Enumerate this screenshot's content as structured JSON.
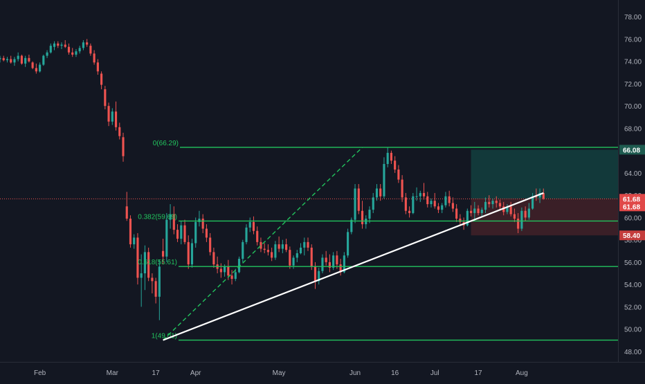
{
  "chart_data": {
    "type": "candlestick",
    "title": "",
    "xlabel": "",
    "ylabel": "",
    "grid": false,
    "colors": {
      "background": "#131722",
      "up": "#26a69a",
      "down": "#ef5350",
      "fib": "#22c55e",
      "trendline": "#ffffff",
      "axis_text": "#b2b5be",
      "target_zone": "#12393a",
      "stop_zone": "#3a1f27",
      "target_tag": "#1e5b50",
      "price_tag": "#e04848",
      "stop_tag": "#c43c3c"
    },
    "y_axis": {
      "ylim": [
        47,
        79.5
      ],
      "ticks": [
        "48.00",
        "50.00",
        "52.00",
        "54.00",
        "56.00",
        "58.00",
        "60.00",
        "62.00",
        "64.00",
        "66.00",
        "68.00",
        "70.00",
        "72.00",
        "74.00",
        "76.00",
        "78.00"
      ],
      "tick_values": [
        48,
        50,
        52,
        54,
        56,
        58,
        60,
        62,
        64,
        66,
        68,
        70,
        72,
        74,
        76,
        78
      ]
    },
    "x_axis": {
      "xlim": [
        0,
        170
      ],
      "labels": [
        {
          "label": "Feb",
          "x": 11
        },
        {
          "label": "Mar",
          "x": 31
        },
        {
          "label": "17",
          "x": 43
        },
        {
          "label": "Apr",
          "x": 54
        },
        {
          "label": "May",
          "x": 77
        },
        {
          "label": "Jun",
          "x": 98
        },
        {
          "label": "16",
          "x": 109
        },
        {
          "label": "Jul",
          "x": 120
        },
        {
          "label": "17",
          "x": 132
        },
        {
          "label": "Aug",
          "x": 144
        }
      ]
    },
    "candles": [
      [
        0,
        74.2,
        74.5,
        73.9,
        74.3
      ],
      [
        1,
        74.3,
        74.5,
        74.0,
        74.1
      ],
      [
        2,
        74.1,
        74.4,
        73.9,
        74.2
      ],
      [
        3,
        74.2,
        74.5,
        73.8,
        73.9
      ],
      [
        4,
        73.9,
        74.4,
        73.6,
        74.2
      ],
      [
        5,
        74.2,
        74.8,
        74.0,
        74.5
      ],
      [
        6,
        74.5,
        74.6,
        73.7,
        73.8
      ],
      [
        7,
        73.8,
        74.5,
        73.5,
        74.3
      ],
      [
        8,
        74.3,
        74.6,
        73.9,
        74.0
      ],
      [
        9,
        73.9,
        74.0,
        73.3,
        73.4
      ],
      [
        10,
        73.4,
        73.8,
        72.9,
        73.1
      ],
      [
        11,
        73.1,
        73.9,
        73.0,
        73.7
      ],
      [
        12,
        73.7,
        74.6,
        73.6,
        74.5
      ],
      [
        13,
        74.5,
        75.0,
        74.3,
        74.8
      ],
      [
        14,
        74.8,
        75.6,
        74.7,
        75.4
      ],
      [
        15,
        75.3,
        75.8,
        75.0,
        75.6
      ],
      [
        16,
        75.6,
        75.8,
        75.2,
        75.4
      ],
      [
        17,
        75.4,
        75.7,
        75.1,
        75.5
      ],
      [
        18,
        75.5,
        75.9,
        75.2,
        75.3
      ],
      [
        19,
        75.3,
        75.6,
        74.6,
        74.8
      ],
      [
        20,
        74.8,
        75.2,
        74.4,
        74.6
      ],
      [
        21,
        74.6,
        75.1,
        74.4,
        74.9
      ],
      [
        22,
        74.9,
        75.4,
        74.7,
        75.2
      ],
      [
        23,
        75.2,
        75.9,
        75.0,
        75.7
      ],
      [
        24,
        75.7,
        76.0,
        75.3,
        75.5
      ],
      [
        25,
        75.4,
        75.6,
        74.5,
        74.7
      ],
      [
        26,
        74.7,
        75.0,
        73.7,
        73.9
      ],
      [
        27,
        73.9,
        74.2,
        72.8,
        73.1
      ],
      [
        28,
        72.9,
        73.1,
        71.5,
        71.9
      ],
      [
        29,
        71.5,
        71.8,
        69.7,
        70.0
      ],
      [
        30,
        70.0,
        70.3,
        68.2,
        68.6
      ],
      [
        31,
        68.6,
        69.8,
        68.3,
        69.5
      ],
      [
        32,
        69.5,
        70.4,
        67.8,
        68.1
      ],
      [
        33,
        68.1,
        68.5,
        67.0,
        67.3
      ],
      [
        34,
        67.2,
        67.6,
        65.0,
        65.5
      ],
      [
        35,
        61.0,
        62.3,
        59.7,
        59.9
      ],
      [
        36,
        59.9,
        60.2,
        57.3,
        57.6
      ],
      [
        37,
        57.6,
        58.5,
        57.2,
        58.2
      ],
      [
        38,
        58.2,
        58.6,
        54.0,
        54.6
      ],
      [
        39,
        54.6,
        56.7,
        52.0,
        55.0
      ],
      [
        40,
        55.0,
        57.5,
        53.5,
        56.9
      ],
      [
        41,
        56.9,
        57.3,
        54.3,
        54.6
      ],
      [
        42,
        54.6,
        55.0,
        53.2,
        54.3
      ],
      [
        43,
        54.3,
        54.6,
        52.3,
        52.9
      ],
      [
        44,
        52.9,
        56.2,
        50.8,
        55.6
      ],
      [
        45,
        57.0,
        58.1,
        55.8,
        56.5
      ],
      [
        46,
        56.5,
        60.4,
        56.0,
        59.8
      ],
      [
        47,
        59.8,
        61.2,
        59.0,
        60.3
      ],
      [
        48,
        60.3,
        61.0,
        58.5,
        58.9
      ],
      [
        49,
        58.9,
        59.4,
        57.8,
        58.1
      ],
      [
        50,
        58.1,
        59.7,
        57.6,
        59.3
      ],
      [
        51,
        59.3,
        59.8,
        57.6,
        57.8
      ],
      [
        52,
        57.8,
        58.4,
        55.4,
        55.8
      ],
      [
        53,
        55.8,
        58.1,
        55.5,
        57.7
      ],
      [
        54,
        57.7,
        60.0,
        57.3,
        59.6
      ],
      [
        55,
        59.6,
        60.6,
        59.2,
        59.9
      ],
      [
        56,
        59.9,
        60.3,
        58.6,
        59.0
      ],
      [
        57,
        59.0,
        59.4,
        57.8,
        58.2
      ],
      [
        58,
        58.2,
        58.6,
        56.6,
        56.9
      ],
      [
        59,
        56.9,
        57.3,
        55.5,
        55.8
      ],
      [
        60,
        55.8,
        56.5,
        55.0,
        55.4
      ],
      [
        61,
        55.4,
        55.9,
        54.6,
        55.1
      ],
      [
        62,
        55.1,
        55.8,
        54.7,
        55.6
      ],
      [
        63,
        55.6,
        56.2,
        54.4,
        54.8
      ],
      [
        64,
        54.8,
        55.3,
        54.0,
        54.5
      ],
      [
        65,
        54.5,
        55.4,
        54.3,
        55.1
      ],
      [
        66,
        55.1,
        56.5,
        55.0,
        56.3
      ],
      [
        67,
        56.3,
        58.0,
        56.0,
        57.8
      ],
      [
        68,
        57.8,
        59.4,
        57.6,
        59.1
      ],
      [
        69,
        59.1,
        60.0,
        58.7,
        59.6
      ],
      [
        70,
        59.6,
        60.1,
        58.5,
        58.8
      ],
      [
        71,
        58.8,
        59.2,
        57.5,
        57.8
      ],
      [
        72,
        57.8,
        58.2,
        56.9,
        57.2
      ],
      [
        73,
        57.2,
        57.7,
        56.8,
        57.1
      ],
      [
        74,
        57.1,
        57.6,
        56.6,
        56.9
      ],
      [
        75,
        56.9,
        57.3,
        56.1,
        56.4
      ],
      [
        76,
        56.4,
        57.9,
        56.2,
        57.6
      ],
      [
        77,
        57.6,
        58.3,
        56.9,
        57.2
      ],
      [
        78,
        57.2,
        58.0,
        56.8,
        57.6
      ],
      [
        79,
        57.6,
        58.1,
        56.9,
        57.1
      ],
      [
        80,
        57.1,
        57.4,
        55.4,
        55.7
      ],
      [
        81,
        55.7,
        56.6,
        55.4,
        56.4
      ],
      [
        82,
        56.4,
        57.1,
        56.0,
        56.8
      ],
      [
        83,
        56.8,
        57.7,
        56.7,
        57.3
      ],
      [
        84,
        57.3,
        58.2,
        56.6,
        57.8
      ],
      [
        85,
        57.8,
        58.2,
        57.0,
        57.3
      ],
      [
        86,
        57.3,
        57.6,
        55.3,
        55.6
      ],
      [
        87,
        55.6,
        56.0,
        53.6,
        54.3
      ],
      [
        88,
        54.3,
        55.5,
        54.0,
        55.2
      ],
      [
        89,
        55.2,
        56.7,
        55.0,
        56.4
      ],
      [
        90,
        56.4,
        57.0,
        55.7,
        56.0
      ],
      [
        91,
        56.0,
        56.7,
        55.1,
        55.5
      ],
      [
        92,
        55.5,
        56.9,
        55.3,
        56.6
      ],
      [
        93,
        56.6,
        57.0,
        55.4,
        55.8
      ],
      [
        94,
        55.8,
        56.3,
        54.8,
        55.1
      ],
      [
        95,
        55.1,
        56.9,
        55.0,
        56.6
      ],
      [
        96,
        56.6,
        59.0,
        56.4,
        58.7
      ],
      [
        97,
        58.7,
        60.0,
        58.5,
        59.8
      ],
      [
        98,
        59.8,
        63.0,
        59.5,
        62.6
      ],
      [
        99,
        62.6,
        63.0,
        60.3,
        60.6
      ],
      [
        100,
        60.6,
        61.5,
        59.0,
        59.4
      ],
      [
        101,
        59.4,
        60.2,
        59.0,
        59.9
      ],
      [
        102,
        59.9,
        61.0,
        59.5,
        60.7
      ],
      [
        103,
        60.7,
        62.2,
        60.4,
        61.8
      ],
      [
        104,
        61.8,
        63.0,
        61.5,
        62.6
      ],
      [
        105,
        62.6,
        63.0,
        61.5,
        61.9
      ],
      [
        106,
        61.9,
        65.4,
        61.7,
        64.8
      ],
      [
        107,
        64.8,
        66.3,
        64.5,
        65.8
      ],
      [
        108,
        65.8,
        66.0,
        64.8,
        65.1
      ],
      [
        109,
        65.1,
        65.5,
        64.0,
        64.3
      ],
      [
        110,
        64.3,
        64.7,
        63.1,
        63.4
      ],
      [
        111,
        63.4,
        63.8,
        61.4,
        61.8
      ],
      [
        112,
        61.8,
        62.2,
        60.3,
        60.6
      ],
      [
        113,
        60.6,
        61.0,
        60.0,
        60.4
      ],
      [
        114,
        60.4,
        62.2,
        60.3,
        61.9
      ],
      [
        115,
        61.9,
        62.7,
        61.5,
        61.9
      ],
      [
        116,
        61.9,
        62.4,
        61.4,
        62.2
      ],
      [
        117,
        62.2,
        63.1,
        61.6,
        61.9
      ],
      [
        118,
        61.9,
        62.3,
        60.9,
        61.2
      ],
      [
        119,
        61.2,
        61.7,
        60.9,
        61.5
      ],
      [
        120,
        61.5,
        62.2,
        60.8,
        61.0
      ],
      [
        121,
        61.0,
        61.3,
        60.4,
        60.7
      ],
      [
        122,
        60.7,
        61.3,
        60.4,
        61.1
      ],
      [
        123,
        61.1,
        62.3,
        60.9,
        61.9
      ],
      [
        124,
        61.9,
        62.4,
        61.0,
        61.3
      ],
      [
        125,
        61.3,
        61.8,
        60.5,
        60.8
      ],
      [
        126,
        60.8,
        61.2,
        59.6,
        59.9
      ],
      [
        127,
        59.9,
        60.3,
        59.3,
        59.6
      ],
      [
        128,
        59.6,
        60.0,
        58.9,
        59.3
      ],
      [
        129,
        59.3,
        60.8,
        59.2,
        60.6
      ],
      [
        130,
        60.6,
        61.1,
        60.1,
        60.4
      ],
      [
        131,
        60.4,
        61.4,
        59.7,
        60.8
      ],
      [
        132,
        60.8,
        61.1,
        60.2,
        60.4
      ],
      [
        133,
        60.4,
        60.9,
        60.0,
        60.7
      ],
      [
        134,
        60.7,
        61.8,
        60.4,
        61.4
      ],
      [
        135,
        61.4,
        62.0,
        60.9,
        61.2
      ],
      [
        136,
        61.2,
        61.7,
        60.8,
        61.5
      ],
      [
        137,
        61.5,
        61.9,
        60.9,
        61.3
      ],
      [
        138,
        61.3,
        61.6,
        60.7,
        61.0
      ],
      [
        139,
        61.0,
        61.4,
        60.2,
        60.5
      ],
      [
        140,
        60.5,
        61.2,
        60.3,
        61.0
      ],
      [
        141,
        61.0,
        61.4,
        60.1,
        60.3
      ],
      [
        142,
        60.3,
        60.8,
        59.6,
        59.9
      ],
      [
        143,
        59.9,
        60.4,
        58.6,
        59.0
      ],
      [
        144,
        59.0,
        60.9,
        58.8,
        60.6
      ],
      [
        145,
        60.6,
        61.0,
        59.7,
        60.0
      ],
      [
        146,
        60.0,
        61.3,
        59.8,
        60.8
      ],
      [
        147,
        60.8,
        62.2,
        60.7,
        61.9
      ],
      [
        148,
        61.9,
        62.6,
        61.5,
        61.8
      ],
      [
        149,
        61.8,
        62.6,
        61.3,
        62.2
      ],
      [
        150,
        62.2,
        62.6,
        61.6,
        61.7
      ]
    ],
    "fib_levels": [
      {
        "ratio": "0",
        "price": 66.29,
        "label": "0(66.29)"
      },
      {
        "ratio": "0.382",
        "price": 59.69,
        "label": "0.382(59.69)"
      },
      {
        "ratio": "0.618",
        "price": 55.61,
        "label": "0.618(55.61)"
      },
      {
        "ratio": "1",
        "price": 49.01,
        "label": "1(49.01)"
      }
    ],
    "trendline": {
      "x1": 45,
      "y1": 49.01,
      "x2": 150,
      "y2": 62.2
    },
    "dashed_line": {
      "x1": 45,
      "y1": 49.01,
      "x2": 100,
      "y2": 66.29
    },
    "position": {
      "x_start": 130,
      "x_end": 170,
      "target": 66.08,
      "entry": 61.68,
      "stop": 58.4
    },
    "current_price_line": 61.68,
    "price_tags": [
      {
        "id": "target",
        "value": "66.08",
        "price": 66.08
      },
      {
        "id": "current",
        "value": "61.68",
        "price": 61.68
      },
      {
        "id": "entry",
        "value": "61.68",
        "price": 61.0
      },
      {
        "id": "stop",
        "value": "58.40",
        "price": 58.4
      }
    ]
  }
}
